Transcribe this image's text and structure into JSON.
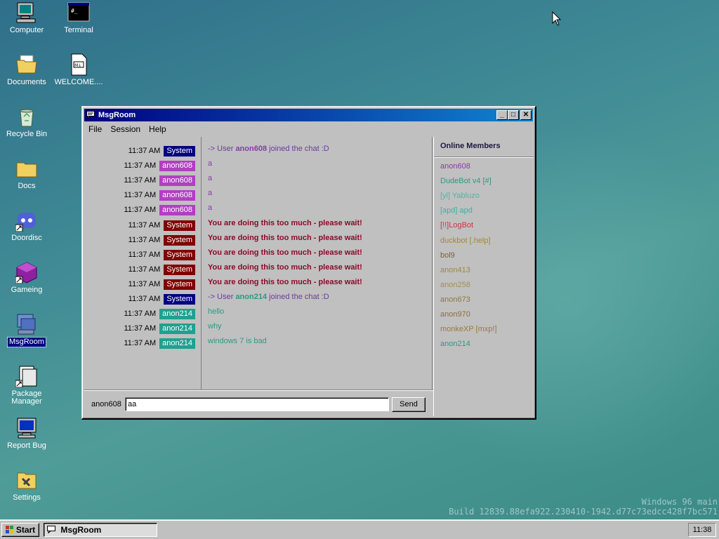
{
  "desktop": {
    "icons": [
      {
        "label": "Computer",
        "icon": "computer-icon"
      },
      {
        "label": "Terminal",
        "icon": "terminal-icon"
      },
      {
        "label": "Documents",
        "icon": "documents-folder-icon"
      },
      {
        "label": "WELCOME....",
        "icon": "markdown-file-icon"
      },
      {
        "label": "Recycle Bin",
        "icon": "recycle-bin-icon"
      },
      {
        "label": "Docs",
        "icon": "docs-folder-icon"
      },
      {
        "label": "Doordisc",
        "icon": "doordisc-icon"
      },
      {
        "label": "Gameing",
        "icon": "gameing-icon"
      },
      {
        "label": "MsgRoom",
        "icon": "msgroom-icon"
      },
      {
        "label": "Package Manager",
        "icon": "package-manager-icon"
      },
      {
        "label": "Report Bug",
        "icon": "report-bug-icon"
      },
      {
        "label": "Settings",
        "icon": "settings-icon"
      }
    ],
    "terminal_glyph": "#_",
    "md_glyph": "M↓",
    "watermark_line1": "Windows 96 main",
    "watermark_line2": "Build 12839.88efa922.230410-1942.d77c73edcc428f7bc571"
  },
  "window": {
    "title": "MsgRoom",
    "buttons": {
      "minimize": "_",
      "maximize": "□",
      "close": "✕"
    },
    "menu": [
      "File",
      "Session",
      "Help"
    ],
    "colors": {
      "system_badge": "#000080",
      "system_warning_badge": "#800000",
      "anon608_badge": "#b040c0",
      "anon214_badge": "#20a090",
      "join_text": "#6a3aa0",
      "warning_text": "#8b0a2a",
      "anon608_text": "#8a3aa8",
      "anon214_text": "#2a9a84"
    },
    "log": [
      {
        "time": "11:37 AM",
        "user": "System",
        "kind": "join",
        "prefix": "-> User ",
        "name": "anon608",
        "suffix": " joined the chat :D"
      },
      {
        "time": "11:37 AM",
        "user": "anon608",
        "kind": "anon608",
        "text": "a"
      },
      {
        "time": "11:37 AM",
        "user": "anon608",
        "kind": "anon608",
        "text": "a"
      },
      {
        "time": "11:37 AM",
        "user": "anon608",
        "kind": "anon608",
        "text": "a"
      },
      {
        "time": "11:37 AM",
        "user": "anon608",
        "kind": "anon608",
        "text": "a"
      },
      {
        "time": "11:37 AM",
        "user": "System",
        "kind": "warn",
        "text": "You are doing this too much - please wait!"
      },
      {
        "time": "11:37 AM",
        "user": "System",
        "kind": "warn",
        "text": "You are doing this too much - please wait!"
      },
      {
        "time": "11:37 AM",
        "user": "System",
        "kind": "warn",
        "text": "You are doing this too much - please wait!"
      },
      {
        "time": "11:37 AM",
        "user": "System",
        "kind": "warn",
        "text": "You are doing this too much - please wait!"
      },
      {
        "time": "11:37 AM",
        "user": "System",
        "kind": "warn",
        "text": "You are doing this too much - please wait!"
      },
      {
        "time": "11:37 AM",
        "user": "System",
        "kind": "join2",
        "prefix": "-> User ",
        "name": "anon214",
        "suffix": " joined the chat :D"
      },
      {
        "time": "11:37 AM",
        "user": "anon214",
        "kind": "anon214",
        "text": "hello"
      },
      {
        "time": "11:37 AM",
        "user": "anon214",
        "kind": "anon214",
        "text": "why"
      },
      {
        "time": "11:37 AM",
        "user": "anon214",
        "kind": "anon214",
        "text": "windows 7 is bad"
      }
    ],
    "members_title": "Online Members",
    "members": [
      {
        "name": "anon608",
        "color": "#8a3aa8"
      },
      {
        "name": "DudeBot v4 [#]",
        "color": "#2a9a84"
      },
      {
        "name": "[yl] Yabluzo",
        "color": "#5ab0a0"
      },
      {
        "name": "[apd] apd",
        "color": "#40b0a0"
      },
      {
        "name": "[!!]LogBot",
        "color": "#d03040"
      },
      {
        "name": "duckbot [.help]",
        "color": "#a08a30"
      },
      {
        "name": "bol9",
        "color": "#7a6040"
      },
      {
        "name": "anon413",
        "color": "#9a8a40"
      },
      {
        "name": "anon258",
        "color": "#a09050"
      },
      {
        "name": "anon673",
        "color": "#8a7a40"
      },
      {
        "name": "anon970",
        "color": "#8a7040"
      },
      {
        "name": "monkeXP [mxp!]",
        "color": "#9a7a3a"
      },
      {
        "name": "anon214",
        "color": "#2a9a84"
      }
    ],
    "input": {
      "nick": "anon608",
      "value": "aa",
      "send_label": "Send"
    }
  },
  "taskbar": {
    "start_label": "Start",
    "task_label": "MsgRoom",
    "clock": "11:38"
  }
}
